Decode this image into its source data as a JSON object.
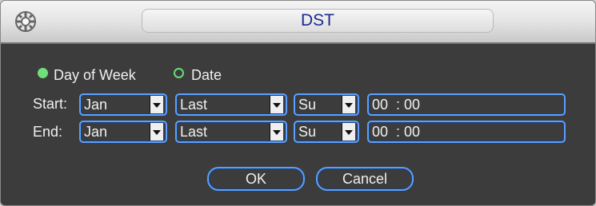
{
  "dialog": {
    "title": "DST",
    "logo_icon": "gear-icon"
  },
  "mode": {
    "options": [
      {
        "label": "Day of Week",
        "selected": true
      },
      {
        "label": "Date",
        "selected": false
      }
    ]
  },
  "start": {
    "label": "Start:",
    "month": "Jan",
    "week": "Last",
    "day": "Su",
    "time": "00  : 00"
  },
  "end": {
    "label": "End:",
    "month": "Jan",
    "week": "Last",
    "day": "Su",
    "time": "00  : 00"
  },
  "buttons": {
    "ok": "OK",
    "cancel": "Cancel"
  },
  "colors": {
    "title": "#1a2b8c",
    "field_border": "#5aa0ff",
    "radio": "#6fe07a",
    "background": "#3c3c3c"
  }
}
